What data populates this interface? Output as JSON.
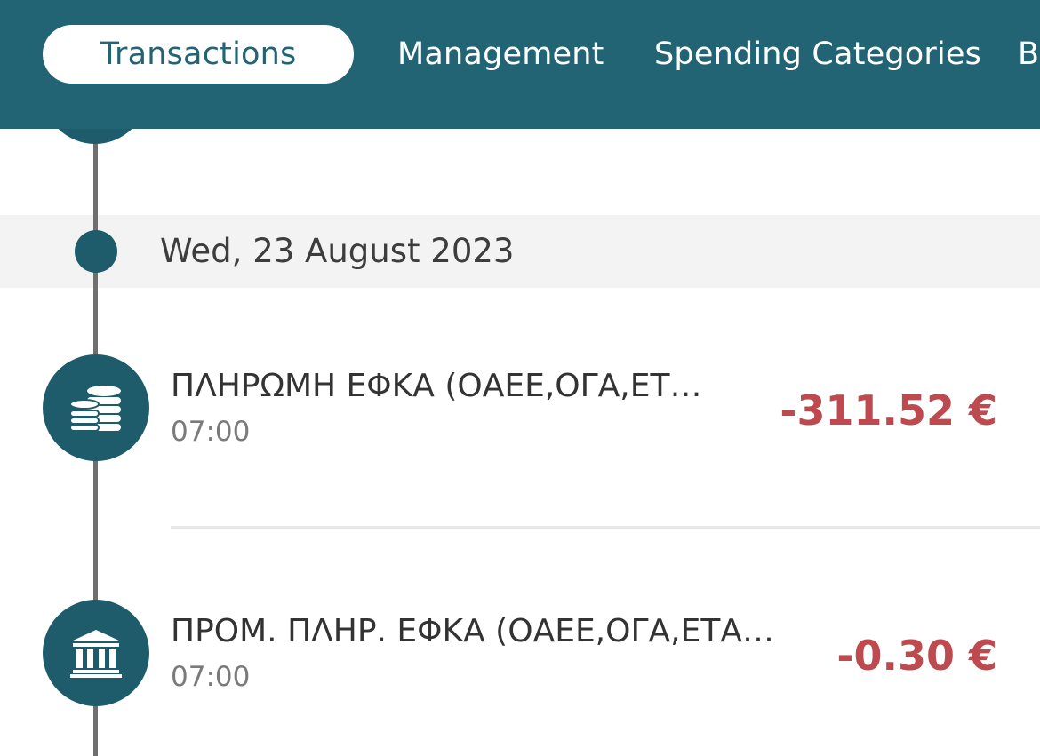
{
  "tabs": [
    {
      "label": "Transactions",
      "active": true
    },
    {
      "label": "Management",
      "active": false
    },
    {
      "label": "Spending Categories",
      "active": false
    },
    {
      "label": "B",
      "active": false
    }
  ],
  "date_header": "Wed, 23 August 2023",
  "transactions": [
    {
      "name": "ΠΛΗΡΩΜΗ ΕΦΚΑ (ΟΑΕΕ,ΟΓΑ,ΕΤ…",
      "time": "07:00",
      "amount": "-311.52 €",
      "icon": "coins-icon"
    },
    {
      "name": "ΠΡΟΜ. ΠΛΗΡ. ΕΦΚΑ (ΟΑΕΕ,ΟΓΑ,ΕΤΑ…",
      "time": "07:00",
      "amount": "-0.30 €",
      "icon": "bank-icon"
    }
  ],
  "colors": {
    "header_bg": "#236474",
    "icon_bg": "#1e5c6c",
    "negative_amount": "#bc4a4f",
    "date_band_bg": "#f3f3f3"
  }
}
